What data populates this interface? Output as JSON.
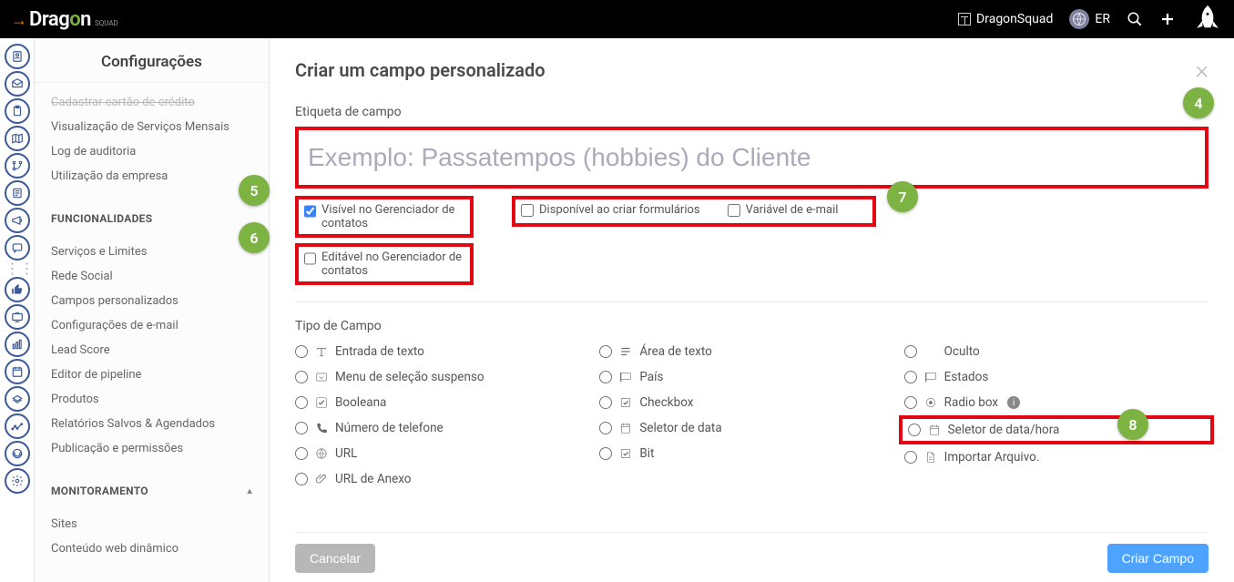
{
  "topbar": {
    "logo": {
      "pre": "Drag",
      "o": "o",
      "post": "n",
      "sub": "SQUAD"
    },
    "org": "DragonSquad",
    "user": "ER"
  },
  "sidebar": {
    "title": "Configurações",
    "group1": [
      {
        "label": "Cadastrar cartão de crédito",
        "clipped": true
      },
      {
        "label": "Visualização de Serviços Mensais"
      },
      {
        "label": "Log de auditoria"
      },
      {
        "label": "Utilização da empresa"
      }
    ],
    "section_func": "FUNCIONALIDADES",
    "func_items": [
      {
        "label": "Serviços e Limites"
      },
      {
        "label": "Rede Social"
      },
      {
        "label": "Campos personalizados"
      },
      {
        "label": "Configurações de e-mail"
      },
      {
        "label": "Lead Score"
      },
      {
        "label": "Editor de pipeline"
      },
      {
        "label": "Produtos"
      },
      {
        "label": "Relatórios Salvos & Agendados"
      },
      {
        "label": "Publicação e permissões"
      }
    ],
    "section_mon": "MONITORAMENTO",
    "mon_items": [
      {
        "label": "Sites"
      },
      {
        "label": "Conteúdo web dinâmico"
      }
    ]
  },
  "modal": {
    "title": "Criar um campo personalizado",
    "field_label": "Etiqueta de campo",
    "placeholder": "Exemplo: Passatempos (hobbies) do Cliente",
    "cb_visible": "Visível no Gerenciador de contatos",
    "cb_editable": "Editável no Gerenciador de contatos",
    "cb_forms": "Disponível ao criar formulários",
    "cb_emailvar": "Variável de e-mail",
    "type_label": "Tipo de Campo",
    "types_col1": [
      {
        "label": "Entrada de texto",
        "icon": "text"
      },
      {
        "label": "Menu de seleção suspenso",
        "icon": "dropdown"
      },
      {
        "label": "Booleana",
        "icon": "check"
      },
      {
        "label": "Número de telefone",
        "icon": "phone"
      },
      {
        "label": "URL",
        "icon": "globe"
      },
      {
        "label": "URL de Anexo",
        "icon": "attach"
      }
    ],
    "types_col2": [
      {
        "label": "Área de texto",
        "icon": "lines"
      },
      {
        "label": "País",
        "icon": "flag"
      },
      {
        "label": "Checkbox",
        "icon": "checkbox"
      },
      {
        "label": "Seletor de data",
        "icon": "calendar"
      },
      {
        "label": "Bit",
        "icon": "checkbox"
      }
    ],
    "types_col3": [
      {
        "label": "Oculto",
        "icon": "none"
      },
      {
        "label": "Estados",
        "icon": "flag"
      },
      {
        "label": "Radio box",
        "icon": "radio",
        "info": true
      },
      {
        "label": "Seletor de data/hora",
        "icon": "calendar",
        "boxed": true
      },
      {
        "label": "Importar Arquivo.",
        "icon": "file"
      }
    ],
    "cancel": "Cancelar",
    "submit": "Criar Campo"
  },
  "callouts": {
    "c4": "4",
    "c5": "5",
    "c6": "6",
    "c7": "7",
    "c8": "8"
  }
}
